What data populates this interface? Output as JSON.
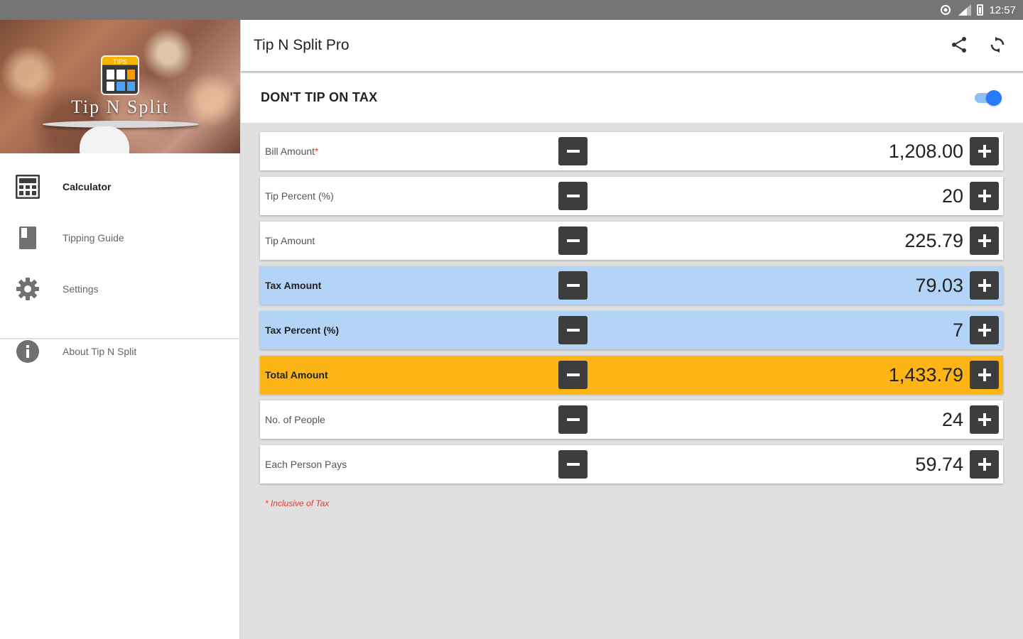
{
  "status_bar": {
    "time": "12:57"
  },
  "drawer": {
    "logo": {
      "badge_text": "TIPS",
      "title": "Tip N Split"
    },
    "items": [
      {
        "label": "Calculator",
        "icon": "calculator-icon",
        "active": true
      },
      {
        "label": "Tipping Guide",
        "icon": "book-icon",
        "active": false
      },
      {
        "label": "Settings",
        "icon": "gear-icon",
        "active": false
      },
      {
        "label": "About Tip N Split",
        "icon": "info-icon",
        "active": false
      }
    ]
  },
  "appbar": {
    "title": "Tip N Split Pro",
    "actions": [
      "share-icon",
      "refresh-icon"
    ]
  },
  "toggle": {
    "label": "DON'T TIP ON TAX",
    "on": true
  },
  "rows": [
    {
      "label": "Bill Amount",
      "required_mark": "*",
      "value": "1,208.00",
      "style": "white"
    },
    {
      "label": "Tip Percent (%)",
      "value": "20",
      "style": "white"
    },
    {
      "label": "Tip Amount",
      "value": "225.79",
      "style": "white"
    },
    {
      "label": "Tax Amount",
      "value": "79.03",
      "style": "blue"
    },
    {
      "label": "Tax Percent (%)",
      "value": "7",
      "style": "blue"
    },
    {
      "label": "Total Amount",
      "value": "1,433.79",
      "style": "orange"
    },
    {
      "label": "No. of People",
      "value": "24",
      "style": "white"
    },
    {
      "label": "Each Person Pays",
      "value": "59.74",
      "style": "white"
    }
  ],
  "footnote": "* Inclusive of Tax",
  "colors": {
    "accent": "#2979ff",
    "tax_row": "#b3d4f7",
    "total_row": "#fdb515",
    "button": "#3d3d3d",
    "required": "#e53935"
  }
}
